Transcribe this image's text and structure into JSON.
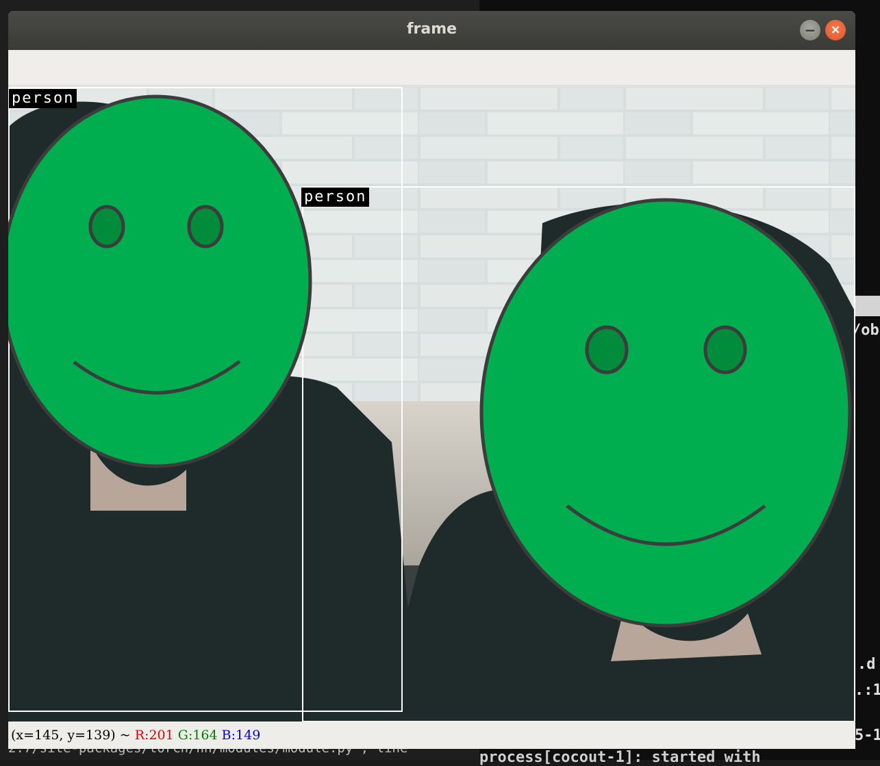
{
  "window": {
    "title": "frame"
  },
  "background_terminal": {
    "frag_ob": "/ob",
    "frag_ld": ".d",
    "frag_1": ".:1",
    "frag_5": "5-1",
    "frag_process": "process[cocout-1]: started with",
    "frag_path": "2.7/site-packages/torch/nn/modules/module.py\", line"
  },
  "detections": [
    {
      "label": "person"
    },
    {
      "label": "person"
    }
  ],
  "status": {
    "coords": "(x=145, y=139) ~ ",
    "r": "R:201",
    "g": "G:164",
    "b": "B:149"
  },
  "colors": {
    "face_fill": "#00ae50",
    "eye_fill": "#018c3c",
    "outline": "#3c3c3c",
    "box": "#ffffff"
  }
}
